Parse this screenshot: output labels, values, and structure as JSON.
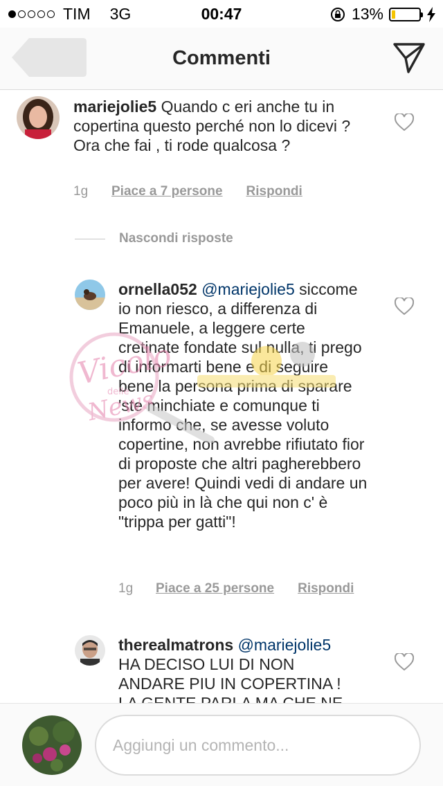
{
  "status_bar": {
    "carrier": "TIM",
    "network": "3G",
    "time": "00:47",
    "battery_percent": "13%",
    "battery_level": 0.13,
    "signal_dots_filled": 1,
    "signal_dots_total": 5
  },
  "nav": {
    "title": "Commenti",
    "back_icon": "back-arrow-icon",
    "send_icon": "send-icon"
  },
  "comments": [
    {
      "username": "mariejolie5",
      "text": "Quando c eri anche tu in copertina questo perché non lo dicevi ?  Ora che fai , ti rode qualcosa ?",
      "age": "1g",
      "likes": "Piace a 7 persone",
      "reply": "Rispondi"
    }
  ],
  "hide_replies_label": "Nascondi risposte",
  "replies": [
    {
      "username": "ornella052",
      "mention": "@mariejolie5",
      "text": "siccome io non riesco, a differenza di Emanuele,  a leggere certe cretinate fondate sul nulla, ti prego di informarti bene e di seguire bene la persona prima di sparare 'ste minchiate e comunque ti informo che, se avesse voluto copertine, non avrebbe rifiutato fior di proposte che altri pagherebbero per avere! Quindi vedi di andare un poco più in là che qui non c' è \"trippa per gatti\"!",
      "age": "1g",
      "likes": "Piace a 25 persone",
      "reply": "Rispondi"
    },
    {
      "username": "therealmatrons",
      "mention": "@mariejolie5",
      "text": "HA DECISO LUI DI NON ANDARE PIU IN COPERTINA ! LA GENTE PARLA MA CHE NE"
    }
  ],
  "input": {
    "placeholder": "Aggiungi un commento..."
  },
  "watermark": {
    "text_main": "Vicolo",
    "text_small": "delle",
    "text_bottom": "News"
  },
  "colors": {
    "accent_link": "#003569",
    "meta_gray": "#999999",
    "battery_yellow": "#f5c400",
    "nav_bg": "#fafafa"
  }
}
